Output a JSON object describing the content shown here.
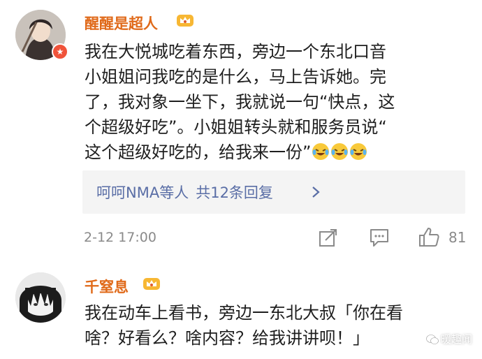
{
  "comments": [
    {
      "username": "醒醒是超人",
      "avatar_icon": "illustrated-portrait",
      "badge_icon": "verified-badge",
      "lines": [
        "我在大悦城吃着东西，旁边一个东北口音",
        "小姐姐问我吃的是什么，马上告诉她。完",
        "了，我对象一坐下，我就说一句“快点，这",
        "个超级好吃”。小姐姐转头就和服务员说“",
        "这个超级好吃的，给我来一份”"
      ],
      "emoji": [
        "laugh-cry-emoji",
        "laugh-cry-emoji",
        "laugh-cry-emoji"
      ],
      "replies": {
        "repliers": "呵呵NMA等人",
        "count_label": "共12条回复"
      },
      "timestamp": "2-12 17:00",
      "likes": "81"
    },
    {
      "username": "千窒息",
      "avatar_icon": "anime-portrait",
      "lines": [
        "我在动车上看书，旁边一东北大叔「你在看",
        "啥？好看么？啥内容？给我讲讲呗！」"
      ]
    }
  ],
  "watermark": "暖趣闻",
  "colors": {
    "username": "#e06a1a",
    "link": "#5a6ea6",
    "meta": "#8a8a8a",
    "reply_bg": "#f4f4f4"
  }
}
